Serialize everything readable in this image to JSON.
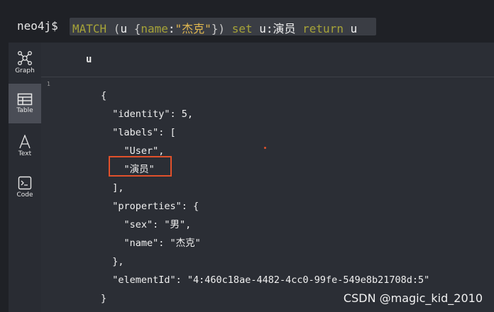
{
  "prompt": "neo4j$",
  "query": {
    "t1": "MATCH",
    "t2": " (",
    "t3": "u",
    "t4": " {",
    "t5": "name",
    "t6": ":",
    "t7": "\"杰克\"",
    "t8": "})",
    "t9": " set ",
    "t10": "u",
    "t11": ":演员",
    "t12": " return ",
    "t13": "u"
  },
  "sidebar": {
    "items": [
      {
        "label": "Graph",
        "icon": "graph-icon"
      },
      {
        "label": "Table",
        "icon": "table-icon",
        "active": true
      },
      {
        "label": "Text",
        "icon": "text-icon"
      },
      {
        "label": "Code",
        "icon": "code-icon"
      }
    ]
  },
  "result": {
    "column": "u",
    "row_number": "1",
    "json_lines": [
      "{",
      "  \"identity\": 5,",
      "  \"labels\": [",
      "    \"User\",",
      "    \"演员\"",
      "  ],",
      "  \"properties\": {",
      "    \"sex\": \"男\",",
      "    \"name\": \"杰克\"",
      "  },",
      "  \"elementId\": \"4:460c18ae-4482-4cc0-99fe-549e8b21708d:5\"",
      "}"
    ]
  },
  "watermark": "CSDN @magic_kid_2010",
  "colors": {
    "highlight": "#e1512b",
    "keyword": "#a6a338",
    "string": "#e0b74f"
  }
}
